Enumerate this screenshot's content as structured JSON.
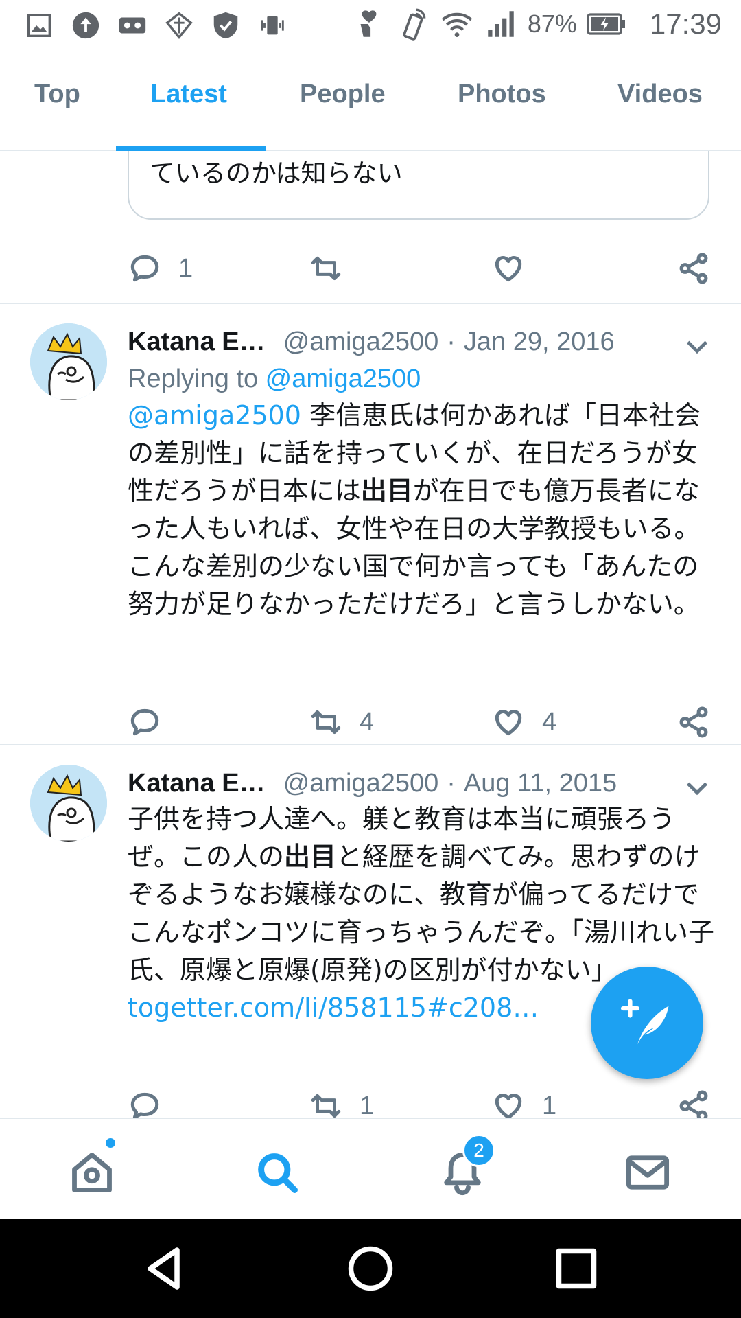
{
  "status_bar": {
    "battery": "87%",
    "time": "17:39",
    "icons": [
      "image-icon",
      "upload-icon",
      "voicemail-icon",
      "vpn-icon",
      "shield-icon",
      "vibrate-icon",
      "heart-hand-icon",
      "tap-icon",
      "wifi-icon",
      "signal-icon",
      "battery-charging-icon"
    ]
  },
  "tabs": [
    {
      "label": "Top"
    },
    {
      "label": "Latest"
    },
    {
      "label": "People"
    },
    {
      "label": "Photos"
    },
    {
      "label": "Videos"
    }
  ],
  "active_tab": "Latest",
  "feed": {
    "partial_tweet": {
      "quote_text": "ているのかは知らない",
      "reply_count": "1"
    },
    "tweets": [
      {
        "name": "Katana E…",
        "handle": "@amiga2500",
        "separator": "·",
        "date": "Jan 29, 2016",
        "replying_prefix": "Replying to ",
        "replying_to": "@amiga2500",
        "mention": "@amiga2500",
        "text_1": " 李信恵氏は何かあれば「日本社会の差別性」に話を持っていくが、在日だろうが女性だろうが日本には",
        "highlight": "出目",
        "text_2": "が在日でも億万長者になった人もいれば、女性や在日の大学教授もいる。こんな差別の少ない国で何か言っても「あんたの努力が足りなかっただけだろ」と言うしかない。",
        "retweets": "4",
        "likes": "4"
      },
      {
        "name": "Katana E…",
        "handle": "@amiga2500",
        "separator": "·",
        "date": "Aug 11, 2015",
        "text_1": "子供を持つ人達へ。躾と教育は本当に頑張ろうぜ。この人の",
        "highlight": "出目",
        "text_2": "と経歴を調べてみ。思わずのけぞるようなお嬢様なのに、教育が偏ってるだけでこんなポンコツに育っちゃうんだぞ。「湯川れい子氏、原爆と原爆(原発)の区別が付かない」",
        "link": "togetter.com/li/858115#c208…",
        "retweets": "1",
        "likes": "1"
      }
    ]
  },
  "bottom_nav": {
    "items": [
      "home-icon",
      "search-icon",
      "notifications-icon",
      "messages-icon"
    ],
    "notification_badge": "2",
    "active": "search"
  },
  "colors": {
    "accent": "#1da1f2",
    "text": "#14171a",
    "secondary": "#657786",
    "divider": "#e1e8ed"
  }
}
